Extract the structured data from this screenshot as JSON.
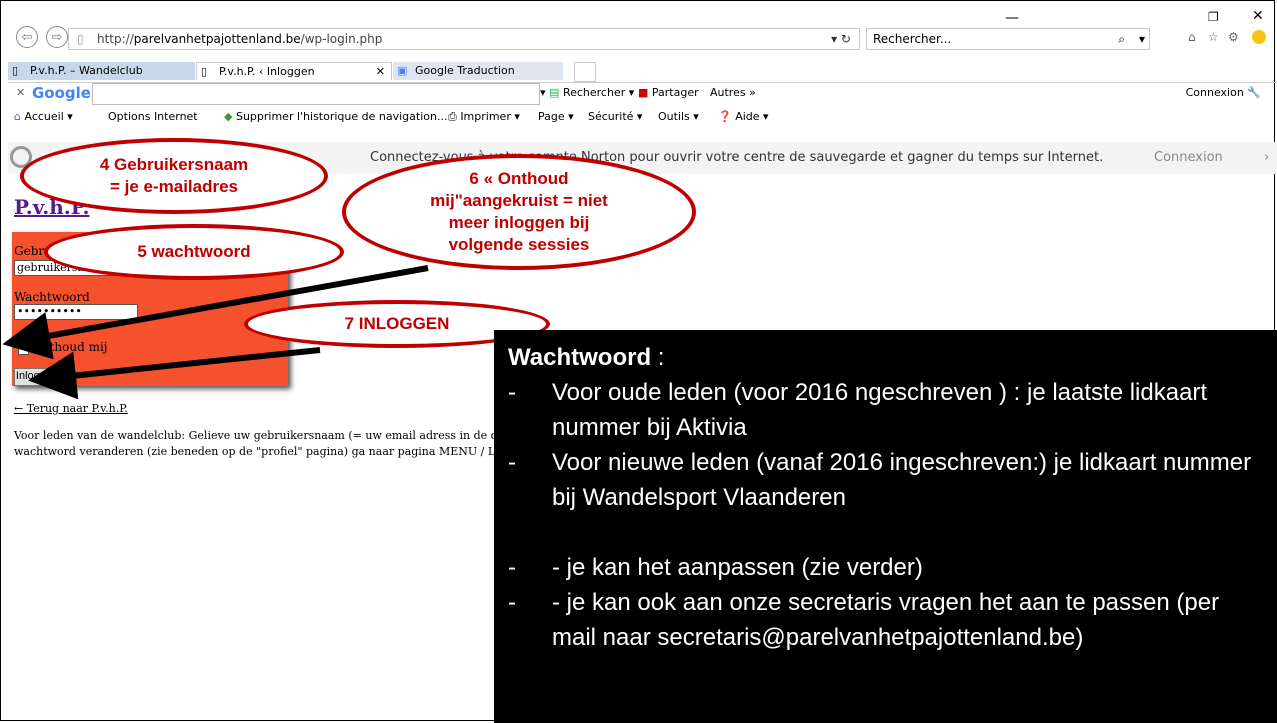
{
  "browser": {
    "address_prefix": "http://",
    "address_domain": "parelvanhetpajottenland.be",
    "address_path": "/wp-login.php",
    "search_placeholder": "Rechercher...",
    "tabs": [
      "P.v.h.P. – Wandelclub",
      "P.v.h.P. ‹ Inloggen",
      "Google Traduction"
    ],
    "google_toolbar": {
      "logo": "Google",
      "search": "Rechercher ▾",
      "share": "Partager",
      "more": "Autres »",
      "signin": "Connexion"
    },
    "command_bar": [
      "Accueil",
      "Options Internet",
      "Supprimer l'historique de navigation...",
      "Imprimer",
      "Page ▾",
      "Sécurité ▾",
      "Outils ▾",
      "Aide ▾"
    ],
    "norton_text": "Connectez-vous à votre compte Norton pour ouvrir votre centre de sauvegarde et gagner du temps sur Internet.",
    "norton_signin": "Connexion"
  },
  "page": {
    "title": "P.v.h.P.",
    "username_label": "Gebruikersnaam",
    "username_value": "gebruikersnaam",
    "password_label": "Wachtwoord",
    "password_value": "••••••••••",
    "remember_label": "Onthoud mij",
    "login_button": "Inloggen",
    "back_link": "← Terug naar P.v.h.P.",
    "description_line1": "Voor leden van de wandelclub: Gelieve uw gebruikersnaam (= uw email adress in de data",
    "description_line2": "wachtword veranderen (zie beneden op de \"profiel\" pagina) ga naar pagina MENU / LED"
  },
  "callouts": {
    "c4_line1": "4 Gebruikersnaam",
    "c4_line2": "= je e-mailadres",
    "c5": "5 wachtwoord",
    "c6_line1": "6 « Onthoud",
    "c6_line2": "mij\"aangekruist = niet",
    "c6_line3": "meer inloggen bij",
    "c6_line4": "volgende sessies",
    "c7": "7 INLOGGEN"
  },
  "overlay": {
    "heading": "Wachtwoord",
    "heading_suffix": " :",
    "items": [
      "Voor oude leden (voor 2016 ngeschreven ) : je laatste lidkaart nummer bij Aktivia",
      "Voor nieuwe  leden (vanaf 2016 ingeschreven:) je lidkaart nummer bij Wandelsport Vlaanderen",
      "- je kan het aanpassen (zie verder)",
      "- je kan ook aan onze secretaris vragen het  aan te passen  (per  mail naar secretaris@parelvanhetpajottenland.be)"
    ],
    "dash": "-"
  },
  "colors": {
    "callout_red": "#c00000",
    "form_bg": "#f4512c",
    "overlay_bg": "#000000"
  }
}
